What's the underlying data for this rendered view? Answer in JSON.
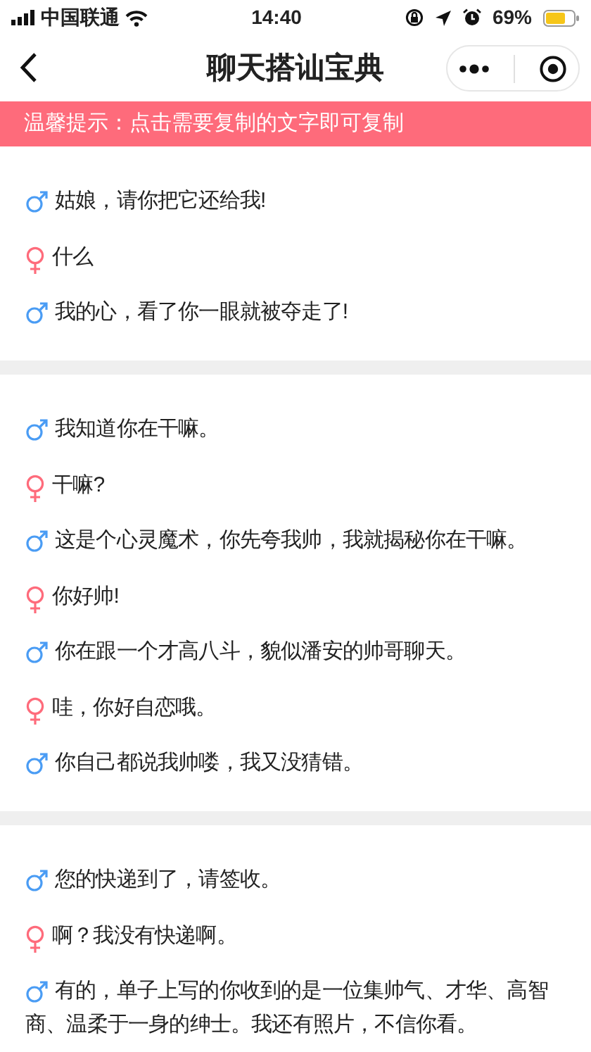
{
  "status_bar": {
    "carrier": "中国联通",
    "time": "14:40",
    "battery": "69%"
  },
  "nav": {
    "title": "聊天搭讪宝典"
  },
  "notice": "温馨提示：点击需要复制的文字即可复制",
  "dialogs": [
    {
      "lines": [
        {
          "kind": "male",
          "text": "姑娘，请你把它还给我!"
        },
        {
          "kind": "female",
          "text": "什么"
        },
        {
          "kind": "male",
          "text": "我的心，看了你一眼就被夺走了!"
        }
      ]
    },
    {
      "lines": [
        {
          "kind": "male",
          "text": "我知道你在干嘛。"
        },
        {
          "kind": "female",
          "text": "干嘛?"
        },
        {
          "kind": "male",
          "text": "这是个心灵魔术，你先夸我帅，我就揭秘你在干嘛。"
        },
        {
          "kind": "female",
          "text": "你好帅!"
        },
        {
          "kind": "male",
          "text": "你在跟一个才高八斗，貌似潘安的帅哥聊天。"
        },
        {
          "kind": "female",
          "text": "哇，你好自恋哦。"
        },
        {
          "kind": "male",
          "text": "你自己都说我帅喽，我又没猜错。"
        }
      ]
    },
    {
      "lines": [
        {
          "kind": "male",
          "text": "您的快递到了，请签收。"
        },
        {
          "kind": "female",
          "text": "啊？我没有快递啊。"
        },
        {
          "kind": "male",
          "text": "有的，单子上写的你收到的是一位集帅气、才华、高智商、温柔于一身的绅士。我还有照片，不信你看。"
        }
      ]
    }
  ]
}
